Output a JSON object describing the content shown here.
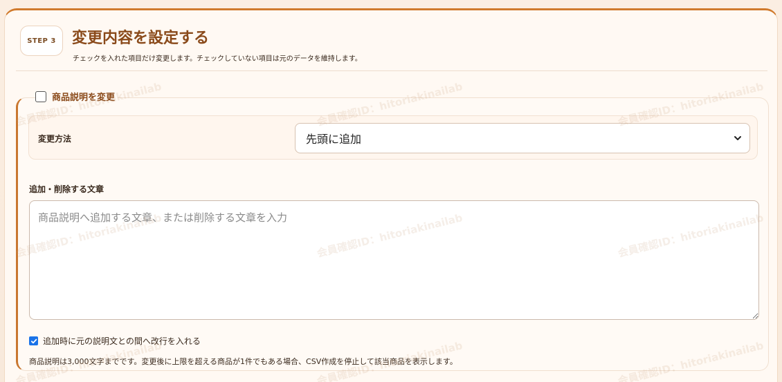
{
  "step": {
    "badge": "STEP 3",
    "title": "変更内容を設定する",
    "subtitle": "チェックを入れた項目だけ変更します。チェックしていない項目は元のデータを維持します。"
  },
  "section": {
    "checkbox_label": "商品説明を変更",
    "checkbox_checked": false,
    "method_label": "変更方法",
    "method_selected": "先頭に追加",
    "text_label": "追加・削除する文章",
    "textarea_value": "",
    "textarea_placeholder": "商品説明へ追加する文章、または削除する文章を入力",
    "newline_label": "追加時に元の説明文との間へ改行を入れる",
    "newline_checked": true,
    "note": "商品説明は3,000文字までです。変更後に上限を超える商品が1件でもある場合、CSV作成を停止して該当商品を表示します。"
  },
  "watermark": {
    "text": "会員確認ID：hitoriakinailab"
  },
  "icons": {
    "select_chevron": "chevron-down-icon",
    "checkmark": "check-icon"
  },
  "colors": {
    "accent": "#d07a2c",
    "title": "#8a4a1a",
    "checkbox_checked": "#1a73e8"
  }
}
